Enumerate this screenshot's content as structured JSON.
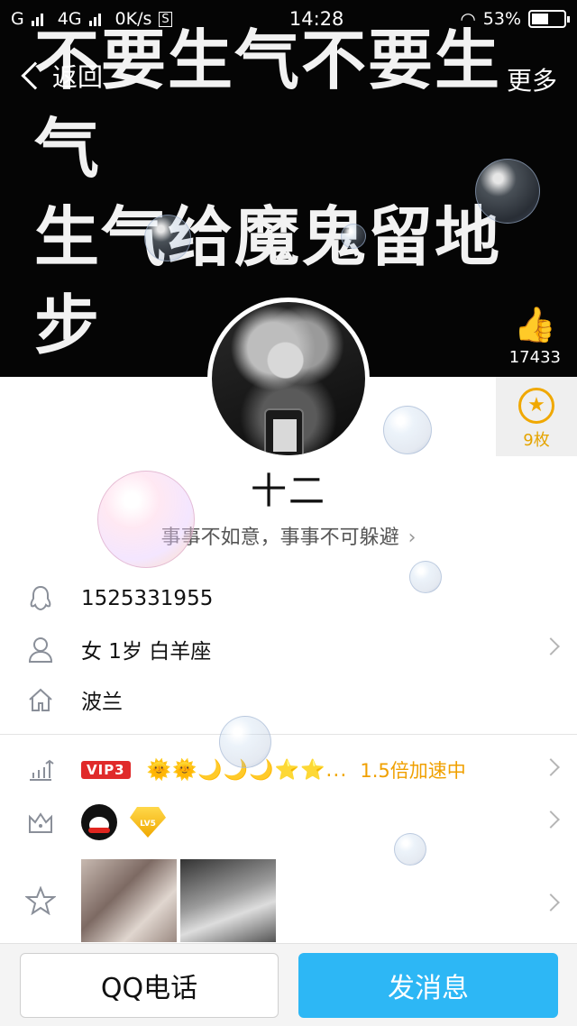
{
  "status_bar": {
    "carrier1": "G",
    "network": "4G",
    "speed": "0K/s",
    "time": "14:28",
    "battery": "53%"
  },
  "nav": {
    "back_label": "返回",
    "more_label": "更多"
  },
  "cover": {
    "text": "不要生气不要生气\n生气给魔鬼留地步\n不要生气不要生气\n生气吃亏是你自己"
  },
  "likes": {
    "count": "17433"
  },
  "medal": {
    "count": "9枚"
  },
  "profile": {
    "name": "十二",
    "signature": "事事不如意，事事不可躲避"
  },
  "info": {
    "qq_number": "1525331955",
    "basic": "女  1岁  白羊座",
    "location": "波兰"
  },
  "vip": {
    "badge": "VIP3",
    "levels": "🌞🌞🌙🌙🌙⭐⭐...",
    "speed_text": "1.5倍加速中"
  },
  "achievements": {
    "level_badge": "LV5"
  },
  "buttons": {
    "call": "QQ电话",
    "message": "发消息"
  },
  "colors": {
    "accent": "#2db7f5",
    "vip_red": "#e02a2a",
    "gold": "#f0a800"
  }
}
